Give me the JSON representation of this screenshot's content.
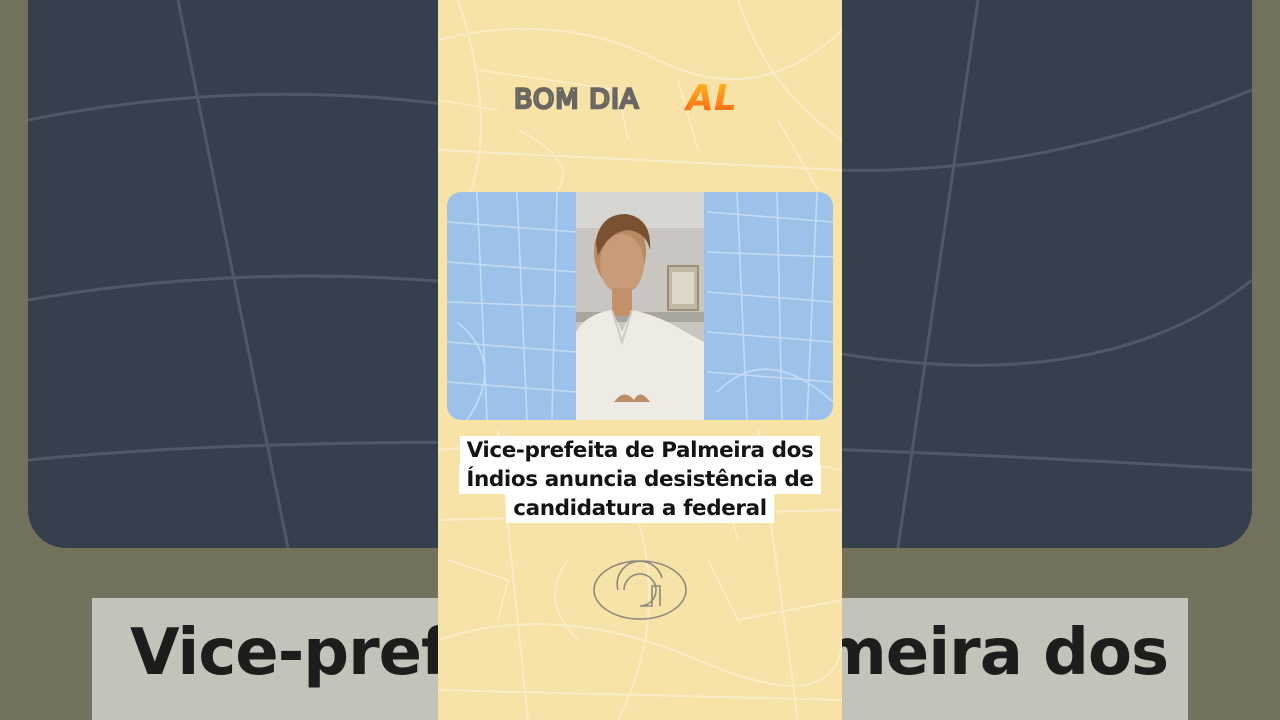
{
  "brand": {
    "logo_text": "BOM DIA",
    "logo_accent": "AL",
    "logo_color": "#6a6762",
    "accent_color_top": "#ffbf1c",
    "accent_color_bottom": "#ff5a14",
    "channel_mark": "g1-globo-icon"
  },
  "headline": {
    "lines": [
      "Vice-prefeita de Palmeira dos",
      "Índios anuncia desistência de",
      "candidatura a federal"
    ]
  },
  "background_caption": {
    "text": "Vice-prefeita de Palmeira dos"
  },
  "colors": {
    "frame_background": "#f7e3a8",
    "map_card": "#9cc2ea",
    "caption_box": "#ffffff",
    "blurred_card": "#354152"
  }
}
